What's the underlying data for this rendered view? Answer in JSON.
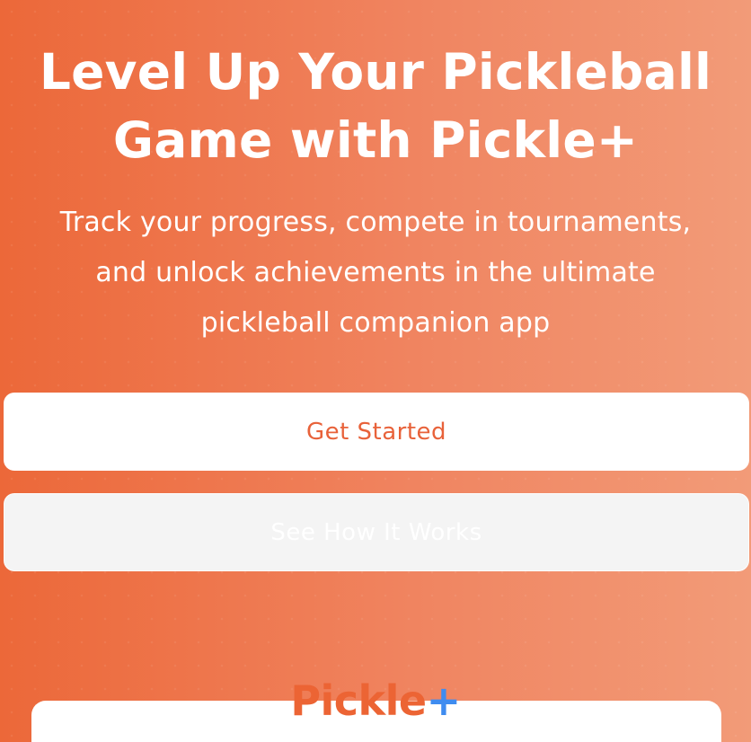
{
  "hero": {
    "title_line1": "Level Up Your Pickleball",
    "title_line2": "Game with Pickle+",
    "subtitle_line1": "Track your progress, compete in tournaments,",
    "subtitle_line2": "and unlock achievements in the ultimate",
    "subtitle_line3": "pickleball companion app"
  },
  "buttons": {
    "primary_label": "Get Started",
    "secondary_label": "See How It Works"
  },
  "logo": {
    "word": "Pickle",
    "plus": "+"
  },
  "colors": {
    "gradient_start": "#EC6839",
    "gradient_end": "#F29B78",
    "accent_orange": "#E8623A",
    "accent_blue": "#3F8CF0"
  }
}
